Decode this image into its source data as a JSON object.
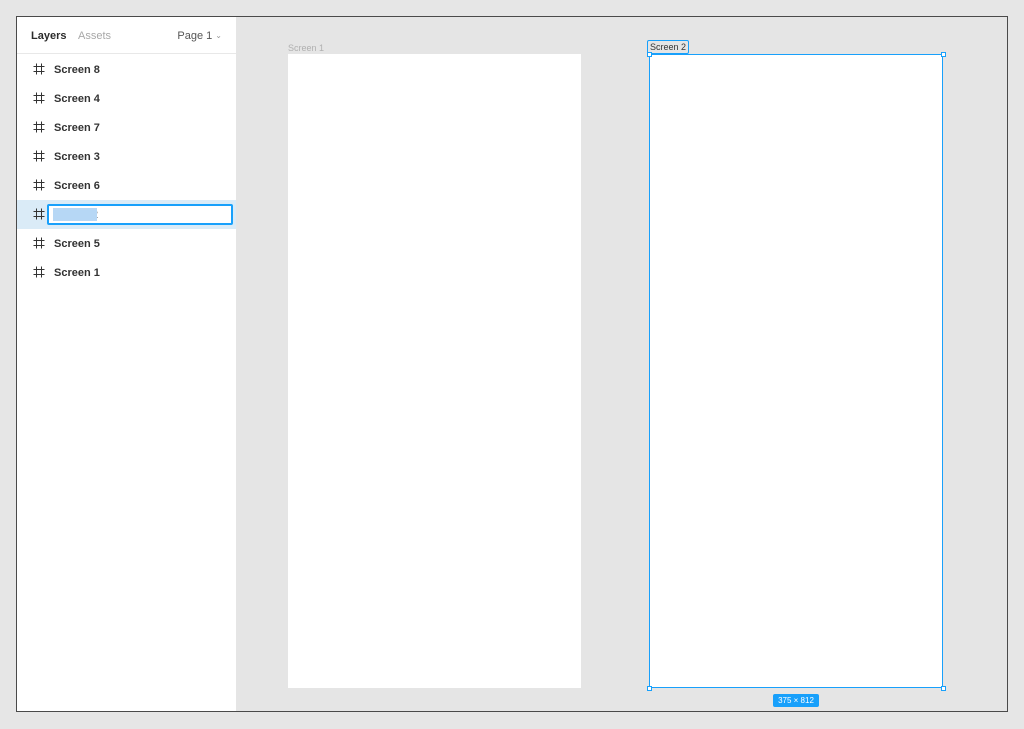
{
  "panel": {
    "tabs": [
      {
        "label": "Layers",
        "active": true
      },
      {
        "label": "Assets",
        "active": false
      }
    ],
    "page_selector": {
      "label": "Page 1",
      "icon": "chevron-down-icon"
    }
  },
  "layers": [
    {
      "name": "Screen 8",
      "icon": "frame-icon",
      "selected": false
    },
    {
      "name": "Screen 4",
      "icon": "frame-icon",
      "selected": false
    },
    {
      "name": "Screen 7",
      "icon": "frame-icon",
      "selected": false
    },
    {
      "name": "Screen 3",
      "icon": "frame-icon",
      "selected": false
    },
    {
      "name": "Screen 6",
      "icon": "frame-icon",
      "selected": false
    },
    {
      "name": "Screen 2",
      "icon": "frame-icon",
      "selected": true,
      "editing": true
    },
    {
      "name": "Screen 5",
      "icon": "frame-icon",
      "selected": false
    },
    {
      "name": "Screen 1",
      "icon": "frame-icon",
      "selected": false
    }
  ],
  "canvas": {
    "frame1": {
      "label": "Screen 1"
    },
    "frame2": {
      "label": "Screen 2",
      "selected": true,
      "size_label": "375 × 812"
    }
  },
  "colors": {
    "accent": "#18a0fb",
    "selected_row": "#daebf7",
    "canvas_bg": "#e5e5e5"
  }
}
